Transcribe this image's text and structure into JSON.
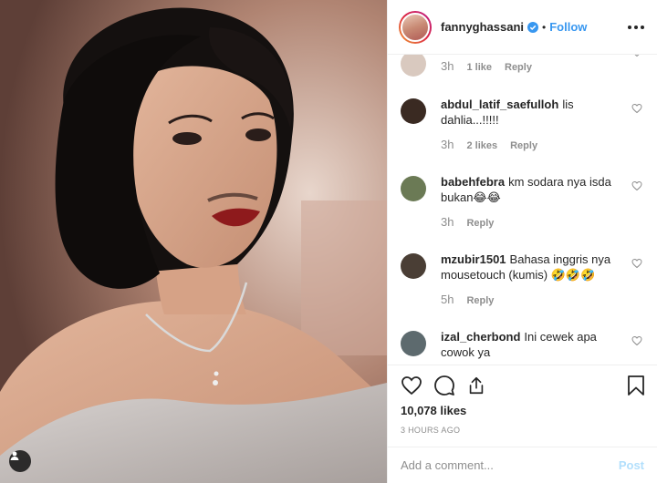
{
  "header": {
    "username": "fannyghassani",
    "separator": "•",
    "follow_label": "Follow"
  },
  "comments": [
    {
      "username": "",
      "text": "",
      "time": "3h",
      "likes": "1 like",
      "reply": "Reply",
      "avatar_color": "#d9c9bf"
    },
    {
      "username": "abdul_latif_saefulloh",
      "text": "lis dahlia...!!!!!",
      "time": "3h",
      "likes": "2 likes",
      "reply": "Reply",
      "avatar_color": "#3a2a22"
    },
    {
      "username": "babehfebra",
      "text": "km sodara nya isda bukan😂😂",
      "time": "3h",
      "likes": "",
      "reply": "Reply",
      "avatar_color": "#6b7a55"
    },
    {
      "username": "mzubir1501",
      "text": "Bahasa inggris nya mousetouch (kumis) 🤣🤣🤣",
      "time": "5h",
      "likes": "",
      "reply": "Reply",
      "avatar_color": "#4a3e35"
    },
    {
      "username": "izal_cherbond",
      "text": "Ini cewek apa cowok ya",
      "time": "",
      "likes": "",
      "reply": "",
      "avatar_color": "#5d6a6e"
    }
  ],
  "post": {
    "likes": "10,078 likes",
    "timestamp": "3 hours ago"
  },
  "add_comment": {
    "placeholder": "Add a comment...",
    "post_label": "Post"
  },
  "colors": {
    "accent": "#3897f0",
    "post_disabled": "#b2dffc",
    "muted": "#8e8e8e"
  }
}
